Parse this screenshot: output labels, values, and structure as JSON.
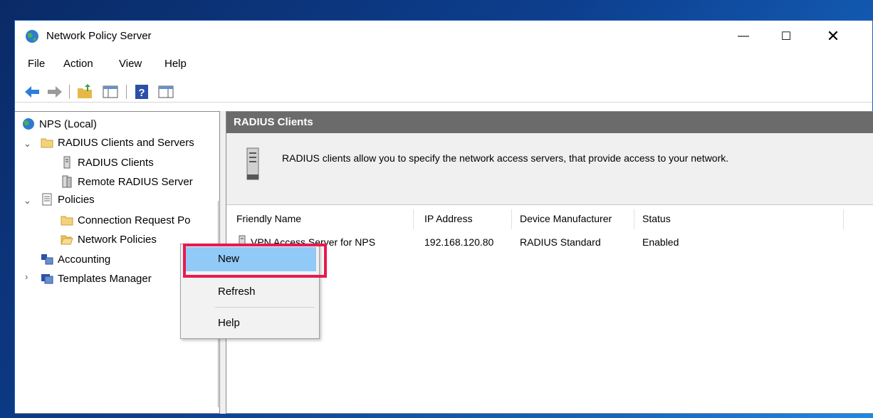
{
  "window": {
    "title": "Network Policy Server"
  },
  "window_controls": {
    "minimize": "—",
    "maximize": "☐",
    "close": "✕"
  },
  "menu": [
    "File",
    "Action",
    "View",
    "Help"
  ],
  "tree": {
    "root": "NPS (Local)",
    "radius_group": "RADIUS Clients and Servers",
    "radius_clients": "RADIUS Clients",
    "remote_radius": "Remote RADIUS Server",
    "policies": "Policies",
    "connection_request": "Connection Request Po",
    "network_policies": "Network Policies",
    "accounting": "Accounting",
    "templates": "Templates Manager"
  },
  "content": {
    "header": "RADIUS Clients",
    "description": "RADIUS clients allow you to specify the network access servers, that provide access to your network.",
    "columns": [
      "Friendly Name",
      "IP Address",
      "Device Manufacturer",
      "Status"
    ],
    "rows": [
      {
        "name": "VPN Access Server for NPS",
        "ip": "192.168.120.80",
        "manufacturer": "RADIUS Standard",
        "status": "Enabled"
      }
    ]
  },
  "context_menu": {
    "items": [
      "New",
      "Refresh",
      "Help"
    ]
  },
  "colors": {
    "highlight": "#e8194f",
    "menu_hover": "#91c9f7",
    "header_bg": "#6b6b6b"
  }
}
